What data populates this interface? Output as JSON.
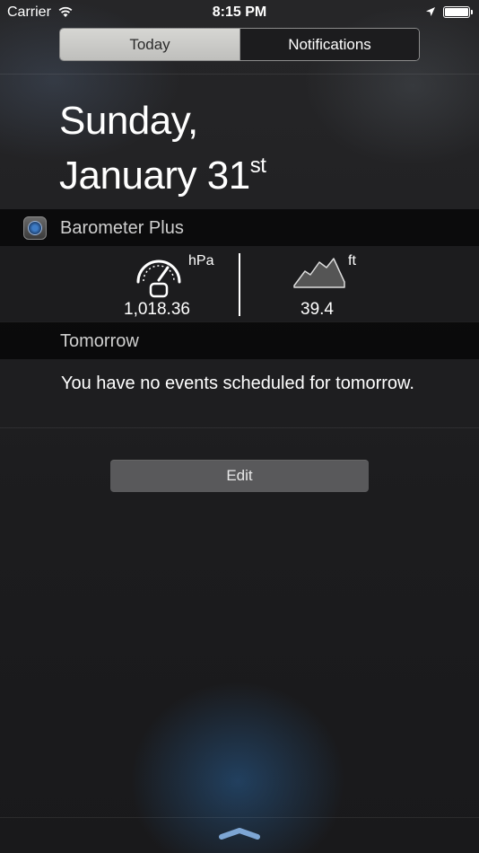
{
  "status_bar": {
    "carrier": "Carrier",
    "time": "8:15 PM",
    "wifi_icon": "wifi-icon",
    "location_icon": "location-arrow-icon",
    "battery_icon": "battery-icon"
  },
  "segmented_control": {
    "tabs": [
      {
        "label": "Today",
        "selected": true
      },
      {
        "label": "Notifications",
        "selected": false
      }
    ]
  },
  "date": {
    "line1": "Sunday,",
    "line2": "January 31",
    "suffix": "st"
  },
  "barometer_widget": {
    "app_name": "Barometer Plus",
    "app_icon": "barometer-app-icon",
    "pressure_unit": "hPa",
    "pressure_value": "1,018.36",
    "altitude_unit": "ft",
    "altitude_value": "39.4",
    "gauge_icon": "gauge-icon",
    "mountain_icon": "mountain-icon"
  },
  "tomorrow_section": {
    "title": "Tomorrow",
    "message": "You have no events scheduled for tomorrow."
  },
  "edit_button": {
    "label": "Edit"
  },
  "colors": {
    "background": "#1f1f21",
    "segment_selected": "#c9c9c6",
    "edit_button": "#59595b"
  }
}
